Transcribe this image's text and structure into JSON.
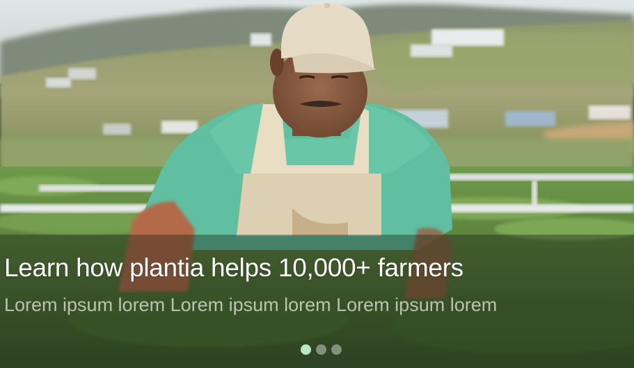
{
  "hero": {
    "headline": "Learn how plantia helps 10,000+ farmers",
    "subline": "Lorem ipsum lorem Lorem ipsum lorem Lorem ipsum lorem",
    "image_alt": "Farmer in green shirt and apron working in a field"
  },
  "carousel": {
    "total_slides": 3,
    "active_index": 0,
    "active_dot_color": "#b9e8c9",
    "inactive_dot_color": "#c8cec4"
  }
}
